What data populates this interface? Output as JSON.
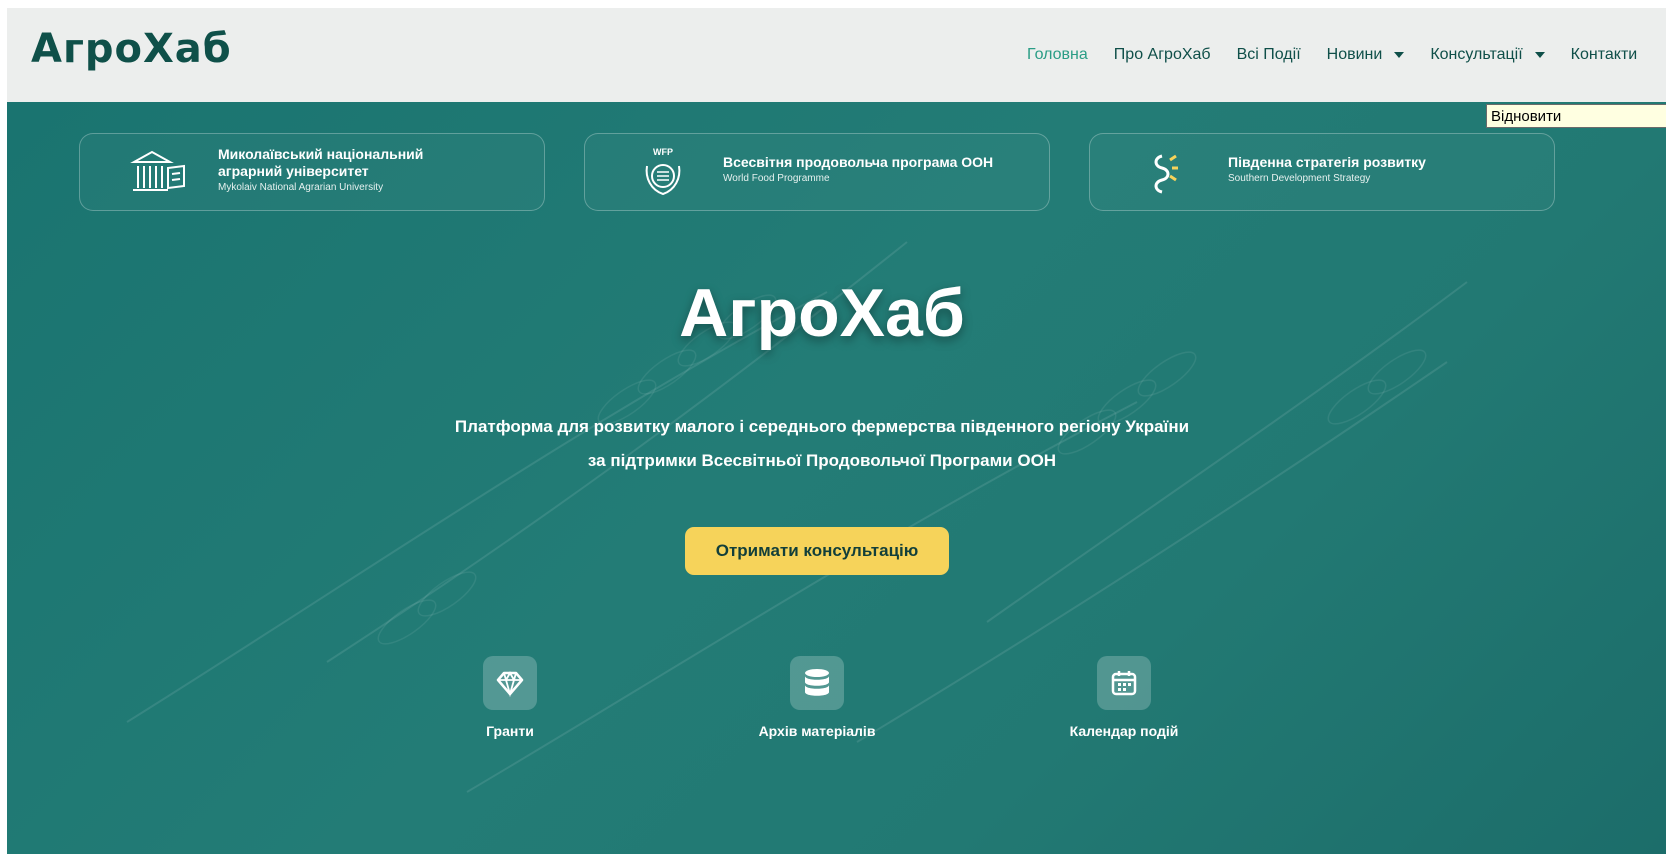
{
  "header": {
    "logo": "АгроХаб",
    "nav": [
      {
        "label": "Головна",
        "active": true
      },
      {
        "label": "Про АгроХаб"
      },
      {
        "label": "Всі Події"
      },
      {
        "label": "Новини",
        "dropdown": true
      },
      {
        "label": "Консультації",
        "dropdown": true
      },
      {
        "label": "Контакти"
      }
    ]
  },
  "partners": [
    {
      "name_line1": "Миколаївський національний",
      "name_line2": "аграрний університет",
      "subtitle": "Mykolaiv National Agrarian University",
      "icon": "university-building-icon"
    },
    {
      "name_line1": "Всесвітня продовольча програма ООН",
      "subtitle": "World Food Programme",
      "icon": "wfp-emblem-icon",
      "icon_text": "WFP"
    },
    {
      "name_line1": "Південна стратегія розвитку",
      "subtitle": "Southern Development Strategy",
      "icon": "sds-logo-icon"
    }
  ],
  "tooltip": "Відновити",
  "hero": {
    "title": "АгроХаб",
    "subtitle_line1": "Платформа для розвитку малого і середнього фермерства південного регіону України",
    "subtitle_line2": "за підтримки Всесвітньої Продовольчої Програми ООН",
    "cta": "Отримати консультацію"
  },
  "features": [
    {
      "label": "Гранти",
      "icon": "diamond-icon"
    },
    {
      "label": "Архів матеріалів",
      "icon": "database-icon"
    },
    {
      "label": "Календар подій",
      "icon": "calendar-icon"
    }
  ],
  "colors": {
    "brand_dark": "#0f5049",
    "nav_active": "#2a9d86",
    "hero_bg": "#227973",
    "cta_bg": "#f6d35a",
    "cta_text": "#123f3a"
  }
}
